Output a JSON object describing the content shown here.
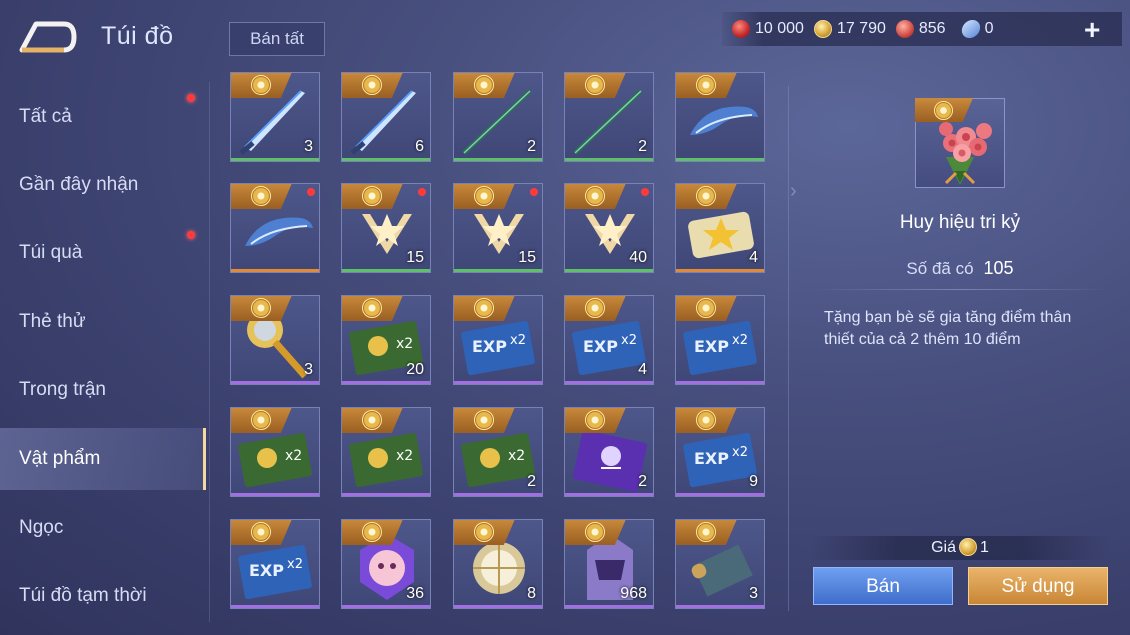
{
  "header": {
    "title": "Túi đồ",
    "sell_all_label": "Bán tất",
    "currencies": [
      {
        "icon": "ruby-icon",
        "value": "10 000"
      },
      {
        "icon": "gold-coin-icon",
        "value": "17 790"
      },
      {
        "icon": "gem-icon",
        "value": "856"
      },
      {
        "icon": "ticket-icon",
        "value": "0"
      }
    ],
    "plus_label": "+"
  },
  "sidebar": {
    "items": [
      {
        "label": "Tất cả",
        "dot": true
      },
      {
        "label": "Gần đây nhận",
        "dot": false
      },
      {
        "label": "Túi quà",
        "dot": true
      },
      {
        "label": "Thẻ thử",
        "dot": false
      },
      {
        "label": "Trong trận",
        "dot": false
      },
      {
        "label": "Vật phẩm",
        "dot": false,
        "active": true
      },
      {
        "label": "Ngọc",
        "dot": false
      },
      {
        "label": "Túi đồ tạm thời",
        "dot": false
      }
    ]
  },
  "grid": {
    "items": [
      {
        "icon": "sword-icon",
        "count": "3",
        "rarity": "green",
        "dot": false
      },
      {
        "icon": "sword-icon",
        "count": "6",
        "rarity": "green",
        "dot": false
      },
      {
        "icon": "spear-icon",
        "count": "2",
        "rarity": "green",
        "dot": false
      },
      {
        "icon": "spear-icon",
        "count": "2",
        "rarity": "green",
        "dot": false
      },
      {
        "icon": "blade-wing-icon",
        "count": "",
        "rarity": "green",
        "dot": false
      },
      {
        "icon": "blade-wing-icon",
        "count": "",
        "rarity": "orange",
        "dot": true
      },
      {
        "icon": "star-emblem-icon",
        "count": "15",
        "rarity": "green",
        "dot": true
      },
      {
        "icon": "star-emblem-icon",
        "count": "15",
        "rarity": "green",
        "dot": true
      },
      {
        "icon": "star-emblem-icon",
        "count": "40",
        "rarity": "green",
        "dot": true
      },
      {
        "icon": "star-ticket-icon",
        "count": "4",
        "rarity": "orange",
        "dot": false
      },
      {
        "icon": "golden-key-icon",
        "count": "3",
        "rarity": "purple",
        "dot": false
      },
      {
        "icon": "gold-x2-card-icon",
        "count": "20",
        "rarity": "purple",
        "dot": false
      },
      {
        "icon": "exp-x2-card-icon",
        "count": "",
        "rarity": "purple",
        "dot": false
      },
      {
        "icon": "exp-x2-card-icon",
        "count": "4",
        "rarity": "purple",
        "dot": false
      },
      {
        "icon": "exp-x2-card-icon",
        "count": "",
        "rarity": "purple",
        "dot": false
      },
      {
        "icon": "gold-x2-card-icon",
        "count": "",
        "rarity": "purple",
        "dot": false
      },
      {
        "icon": "gold-x2-card-icon",
        "count": "",
        "rarity": "purple",
        "dot": false
      },
      {
        "icon": "gold-x2-card-icon",
        "count": "2",
        "rarity": "purple",
        "dot": false
      },
      {
        "icon": "arcana-card-icon",
        "count": "2",
        "rarity": "purple",
        "dot": false
      },
      {
        "icon": "exp-x2-card-icon",
        "count": "9",
        "rarity": "purple",
        "dot": false
      },
      {
        "icon": "exp-x2-card-icon",
        "count": "",
        "rarity": "purple",
        "dot": false
      },
      {
        "icon": "emote-badge-icon",
        "count": "36",
        "rarity": "purple",
        "dot": false
      },
      {
        "icon": "orb-icon",
        "count": "8",
        "rarity": "purple",
        "dot": false
      },
      {
        "icon": "helmet-icon",
        "count": "968",
        "rarity": "purple",
        "dot": false
      },
      {
        "icon": "scroll-map-icon",
        "count": "3",
        "rarity": "purple",
        "dot": false
      }
    ]
  },
  "detail": {
    "icon": "rose-bouquet-icon",
    "name": "Huy hiệu tri kỷ",
    "owned_label": "Số đã có",
    "owned_value": "105",
    "description": "Tặng bạn bè sẽ gia tăng điểm thân thiết của cả 2 thêm 10 điểm",
    "price_label": "Giá",
    "price_value": "1",
    "sell_label": "Bán",
    "use_label": "Sử dụng"
  },
  "colors": {
    "rarity_green": "#5fbf6a",
    "rarity_orange": "#e08a3a",
    "rarity_purple": "#a070e0",
    "sell_button": "#4f7fdc",
    "use_button": "#d9994a"
  }
}
